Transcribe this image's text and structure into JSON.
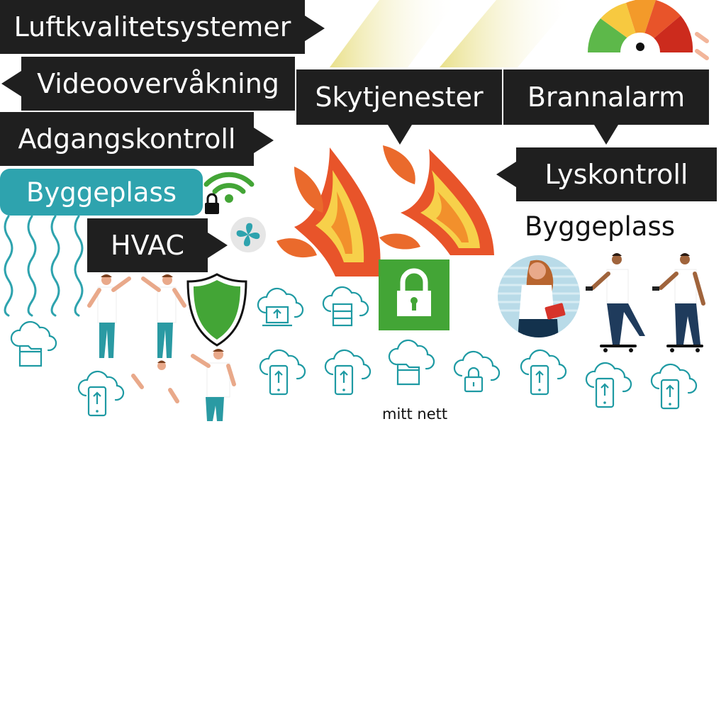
{
  "labels": {
    "luftkvalitet": "Luftkvalitetsystemer",
    "video": "Videoovervåkning",
    "adgang": "Adgangskontroll",
    "byggeplass_badge": "Byggeplass",
    "hvac": "HVAC",
    "skytjenester": "Skytjenester",
    "brannalarm": "Brannalarm",
    "lyskontroll": "Lyskontroll",
    "byggeplass_title": "Byggeplass",
    "mitt_nett": "mitt nett"
  },
  "colors": {
    "label_bg": "#1f1f1f",
    "teal": "#2ea3ae",
    "icon_teal": "#1e9aa3",
    "green": "#43a536",
    "flame_red": "#e8542a",
    "flame_orange": "#f2902c",
    "flame_yellow": "#f7d04a",
    "gauge": [
      "#5db84a",
      "#f7c940",
      "#f39a2a",
      "#e8542a",
      "#cc2b1d"
    ]
  },
  "icons": {
    "gauge": "air-quality-gauge-icon",
    "wifi": "wifi-lock-icon",
    "fan": "fan-icon",
    "shield": "security-shield-icon",
    "padlock": "padlock-icon",
    "cloud_upload_laptop": "cloud-upload-laptop-icon",
    "cloud_server": "cloud-server-icon",
    "cloud_phone": "cloud-phone-icon",
    "cloud_folder": "cloud-folder-icon",
    "cloud_lock": "cloud-lock-icon",
    "flames": "fire-icon",
    "waves": "heat-waves-icon"
  }
}
